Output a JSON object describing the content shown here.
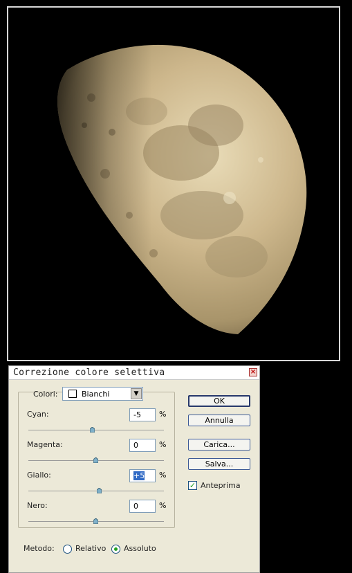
{
  "dialog": {
    "title": "Correzione colore selettiva",
    "close_glyph": "×",
    "colori_label": "Colori:",
    "colori_value": "Bianchi",
    "sliders": [
      {
        "label": "Cyan:",
        "value": "-5",
        "unit": "%",
        "level": -5
      },
      {
        "label": "Magenta:",
        "value": "0",
        "unit": "%",
        "level": 0
      },
      {
        "label": "Giallo:",
        "value": "+5",
        "unit": "%",
        "level": 5
      },
      {
        "label": "Nero:",
        "value": "0",
        "unit": "%",
        "level": 0
      }
    ],
    "buttons": {
      "ok": "OK",
      "annulla": "Annulla",
      "carica": "Carica...",
      "salva": "Salva..."
    },
    "anteprima_label": "Anteprima",
    "anteprima_checked": true,
    "metodo": {
      "label": "Metodo:",
      "options": [
        "Relativo",
        "Assoluto"
      ],
      "selected": "Assoluto"
    }
  },
  "colors": {
    "dialog_bg": "#ece9d8",
    "accent_green": "#21a121",
    "selection_blue": "#316ac5"
  }
}
